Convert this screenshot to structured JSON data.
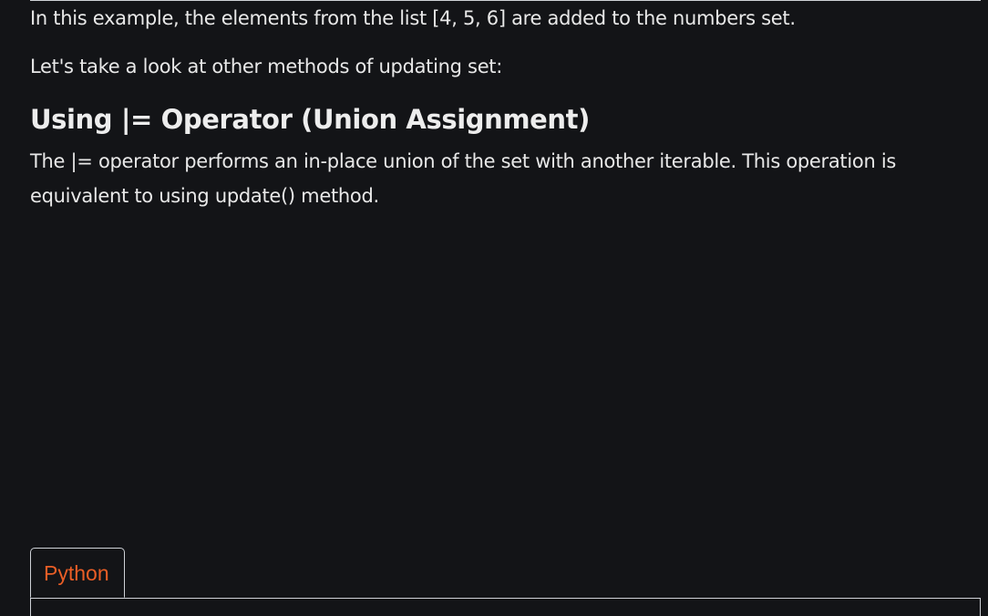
{
  "content": {
    "paragraph_1": "In this example, the elements from the list [4, 5, 6] are added to the numbers set.",
    "paragraph_2": "Let's take a look at other methods of updating set:",
    "heading": "Using |= Operator (Union Assignment)",
    "paragraph_3": "The |= operator performs an in-place union of the set with another iterable. This operation is equivalent to using update() method."
  },
  "code_block": {
    "active_tab_label": "Python"
  },
  "colors": {
    "background": "#131417",
    "text": "#e8e8e8",
    "tab_accent": "#ea5e26",
    "border": "#cfd2d7"
  }
}
